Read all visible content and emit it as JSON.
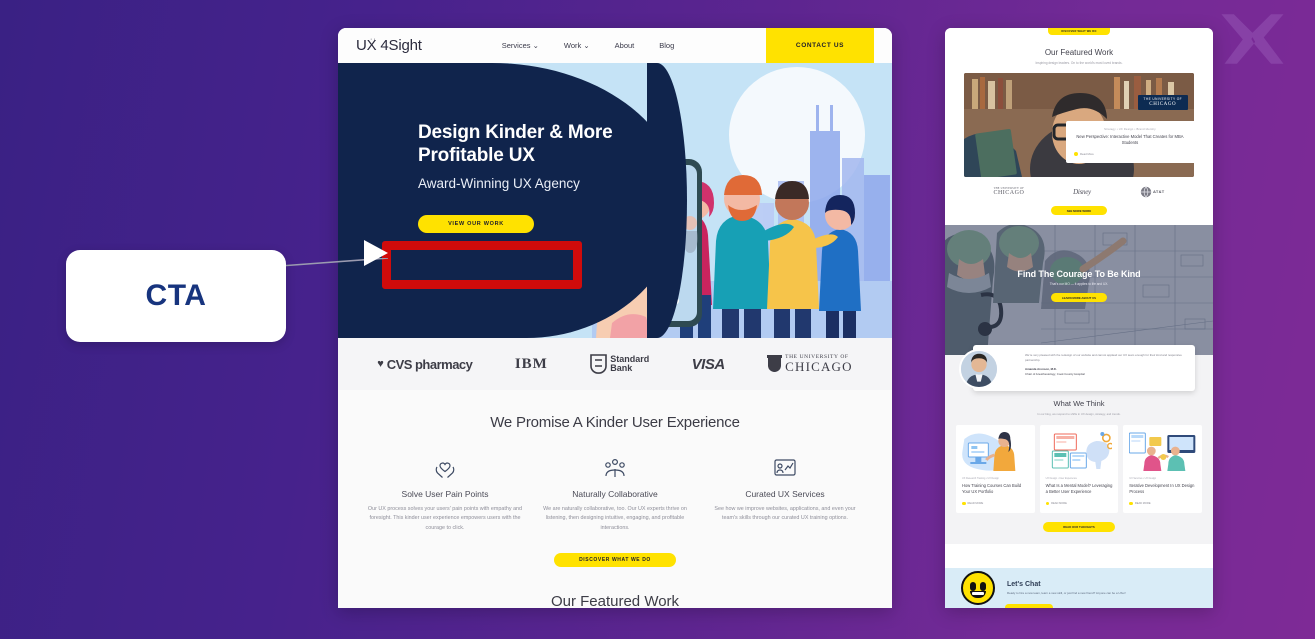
{
  "watermark": {
    "name": "x-logo-watermark"
  },
  "annotation": {
    "label": "CTA",
    "target": "view-our-work-button"
  },
  "main_mock": {
    "nav": {
      "logo": "UX 4Sight",
      "links": [
        {
          "label": "Services",
          "has_caret": true
        },
        {
          "label": "Work",
          "has_caret": true
        },
        {
          "label": "About",
          "has_caret": false
        },
        {
          "label": "Blog",
          "has_caret": false
        }
      ],
      "contact_label": "CONTACT US"
    },
    "hero": {
      "heading": "Design Kinder & More Profitable UX",
      "subheading": "Award-Winning UX Agency",
      "button_label": "VIEW OUR WORK"
    },
    "clients": [
      {
        "name": "cvs-pharmacy-logo",
        "text": "CVS",
        "text2": "pharmacy"
      },
      {
        "name": "ibm-logo",
        "text": "IBM"
      },
      {
        "name": "standard-bank-logo",
        "text": "Standard",
        "text2": "Bank"
      },
      {
        "name": "visa-logo",
        "text": "VISA"
      },
      {
        "name": "university-of-chicago-logo",
        "text": "THE UNIVERSITY OF",
        "text2": "CHICAGO"
      }
    ],
    "promise": {
      "heading": "We Promise A Kinder User Experience",
      "cards": [
        {
          "icon": "heart-in-hands-icon",
          "title": "Solve User Pain Points",
          "body": "Our UX process solves your users' pain points with empathy and foresight. This kinder user experience empowers users with the courage to click."
        },
        {
          "icon": "collaboration-people-icon",
          "title": "Naturally Collaborative",
          "body": "We are naturally collaborative, too. Our UX experts thrive on listening, then designing intuitive, engaging, and profitable interactions."
        },
        {
          "icon": "chart-presentation-icon",
          "title": "Curated UX Services",
          "body": "See how we improve websites, applications, and even your team's skills through our curated UX training options."
        }
      ],
      "button_label": "DISCOVER WHAT WE DO"
    },
    "featured_heading": "Our Featured Work"
  },
  "side_mock": {
    "top_pill_label": "DISCOVER WHAT WE DO",
    "featured": {
      "heading": "Our Featured Work",
      "subheading": "Inspiring design leaders. On to the world's most loved brands.",
      "badge_top": "THE UNIVERSITY OF",
      "badge_bottom": "CHICAGO",
      "card_category": "Strategy • UX Design • Brand Identity",
      "card_title": "New Perspective: Interactive Model That Creates for MBA Students",
      "card_more": "Read More",
      "clients": [
        {
          "name": "university-of-chicago-logo",
          "t": "THE UNIVERSITY OF",
          "c": "CHICAGO"
        },
        {
          "name": "disney-logo",
          "t": "Disney"
        },
        {
          "name": "att-logo",
          "t": "AT&T"
        }
      ],
      "see_more_label": "SEE MORE WORK"
    },
    "courage": {
      "heading": "Find The Courage To Be Kind",
      "subheading": "That's our MO — it applies to life and UX.",
      "button_label": "LEARN MORE ABOUT US",
      "quote": "We're very pleased with the redesign of our website and cannot applaud our UX team enough for their kind and responsive partnership.",
      "author": "Amanda Aronson, M.D.",
      "author_role": "Chair of Anesthesiology, Cook County Hospital"
    },
    "think": {
      "heading": "What We Think",
      "subheading": "In our blog, we respond to shifts in UX design, strategy, and trends.",
      "posts": [
        {
          "category": "UX Research Training • UX Design",
          "title": "How Training Courses Can Build Your UX Portfolio",
          "read_more": "READ MORE"
        },
        {
          "category": "UX Design • User Experience",
          "title": "What Is a Mental Model? Leveraging a Better User Experience",
          "read_more": "READ MORE"
        },
        {
          "category": "UX Services • UX Design",
          "title": "Iterative Development In UX Design Process",
          "read_more": "READ MORE"
        }
      ],
      "button_label": "READ OUR THOUGHTS"
    },
    "chat": {
      "icon": "smiley-face-icon",
      "title": "Let's Chat",
      "body": "Ready to hire a new team, learn a new skill, or just find a new friend? Anyone can be a UXer!"
    }
  },
  "colors": {
    "background_purple": "#46228c",
    "accent_yellow": "#ffe200",
    "navy": "#10244c",
    "highlight_red": "#d00b0b",
    "cta_text_blue": "#17347e"
  }
}
